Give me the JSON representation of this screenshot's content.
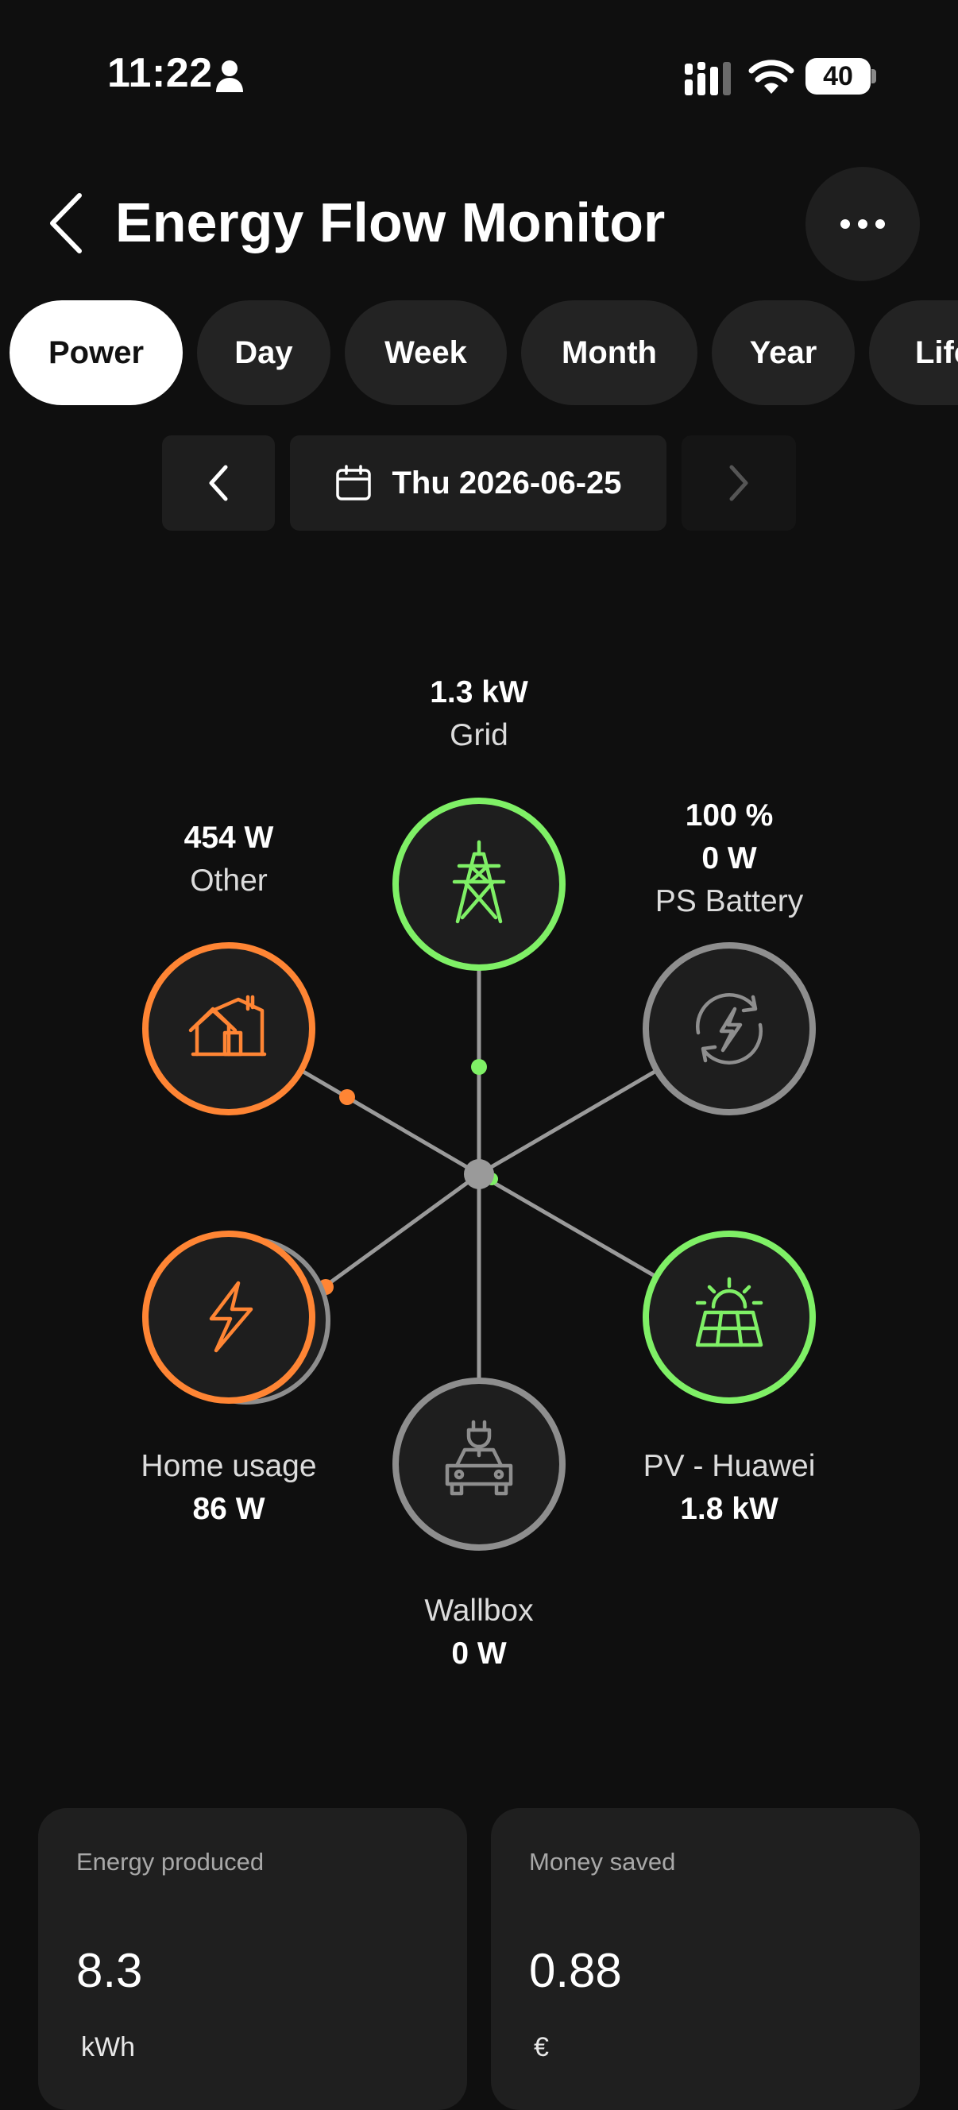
{
  "status_bar": {
    "time": "11:22",
    "battery": "40",
    "icons": [
      "person-icon",
      "signal-icon",
      "wifi-icon",
      "battery-icon"
    ]
  },
  "header": {
    "title": "Energy Flow Monitor",
    "back_icon": "chevron-left-icon",
    "more_icon": "more-horizontal-icon"
  },
  "tabs": [
    {
      "label": "Power",
      "active": true
    },
    {
      "label": "Day",
      "active": false
    },
    {
      "label": "Week",
      "active": false
    },
    {
      "label": "Month",
      "active": false
    },
    {
      "label": "Year",
      "active": false
    },
    {
      "label": "Lifetime",
      "active": false
    }
  ],
  "date_nav": {
    "date": "Thu 2026-06-25",
    "prev_icon": "chevron-left-icon",
    "next_icon": "chevron-right-icon",
    "calendar_icon": "calendar-icon"
  },
  "flow": {
    "grid": {
      "value": "1.3  kW",
      "name": "Grid",
      "icon": "power-tower-icon",
      "color": "#7ff066"
    },
    "other": {
      "value": "454  W",
      "name": "Other",
      "icon": "house-icon",
      "color": "#ff8534"
    },
    "battery": {
      "percent": "100 %",
      "value": "0  W",
      "name": "PS Battery",
      "icon": "battery-cycle-icon",
      "color": "#8e8e8e"
    },
    "home": {
      "value": "86  W",
      "name": "Home usage",
      "icon": "lightning-icon",
      "color": "#ff8534"
    },
    "pv": {
      "value": "1.8  kW",
      "name": "PV - Huawei",
      "icon": "solar-panel-icon",
      "color": "#7ff066"
    },
    "wallbox": {
      "value": "0  W",
      "name": "Wallbox",
      "icon": "car-charger-icon",
      "color": "#8e8e8e"
    }
  },
  "cards": [
    {
      "label": "Energy produced",
      "value": "8.3",
      "unit": "kWh"
    },
    {
      "label": "Money saved",
      "value": "0.88",
      "unit": "€"
    }
  ]
}
